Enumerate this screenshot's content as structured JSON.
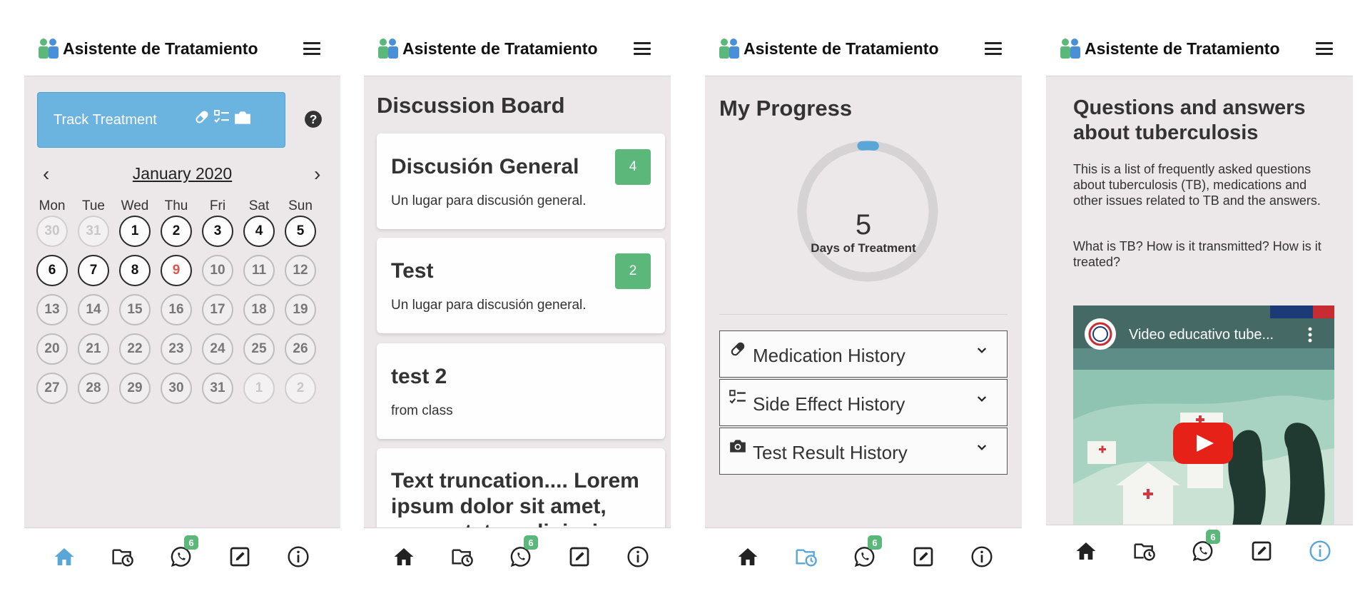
{
  "app": {
    "title": "Asistente de Tratamiento",
    "colors": {
      "accent": "#6cb4e0",
      "badge_green": "#5cb87a",
      "today_red": "#e0554f",
      "background": "#ece7e9"
    }
  },
  "nav": {
    "items": [
      "home-icon",
      "folder-clock-icon",
      "whatsapp-icon",
      "edit-icon",
      "info-icon"
    ],
    "chat_badge": "6"
  },
  "calendar_screen": {
    "track_button": "Track Treatment",
    "month": "January 2020",
    "prev": "‹",
    "next": "›",
    "weekdays": [
      "Mon",
      "Tue",
      "Wed",
      "Thu",
      "Fri",
      "Sat",
      "Sun"
    ],
    "days": [
      [
        "30",
        "31",
        "1",
        "2",
        "3",
        "4",
        "5"
      ],
      [
        "6",
        "7",
        "8",
        "9",
        "10",
        "11",
        "12"
      ],
      [
        "13",
        "14",
        "15",
        "16",
        "17",
        "18",
        "19"
      ],
      [
        "20",
        "21",
        "22",
        "23",
        "24",
        "25",
        "26"
      ],
      [
        "27",
        "28",
        "29",
        "30",
        "31",
        "1",
        "2"
      ]
    ],
    "active_nav": "home"
  },
  "discussion_screen": {
    "title": "Discussion Board",
    "cards": [
      {
        "title": "Discusión General",
        "subtitle": "Un lugar para discusión general.",
        "badge": "4"
      },
      {
        "title": "Test",
        "subtitle": "Un lugar para discusión general.",
        "badge": "2"
      },
      {
        "title": "test 2",
        "subtitle": "from class",
        "badge": ""
      },
      {
        "title": "Text truncation.... Lorem ipsum dolor sit amet, consectetur adipiscing",
        "subtitle": "",
        "badge": ""
      }
    ]
  },
  "progress_screen": {
    "title": "My Progress",
    "days_count": "5",
    "days_label": "Days of Treatment",
    "progress_fraction": 0.03,
    "accordion": [
      {
        "label": "Medication History",
        "icon": "pill-icon"
      },
      {
        "label": "Side Effect History",
        "icon": "checklist-icon"
      },
      {
        "label": "Test Result History",
        "icon": "camera-icon"
      }
    ],
    "active_nav": "folder"
  },
  "info_screen": {
    "title": "Questions and answers about tuberculosis",
    "paragraph1": "This is a list of frequently asked questions about tuberculosis (TB), medications and other issues related to TB and the answers.",
    "paragraph2": "What is TB? How is it transmitted? How is it treated?",
    "video_title": "Video educativo tube...",
    "active_nav": "info"
  }
}
